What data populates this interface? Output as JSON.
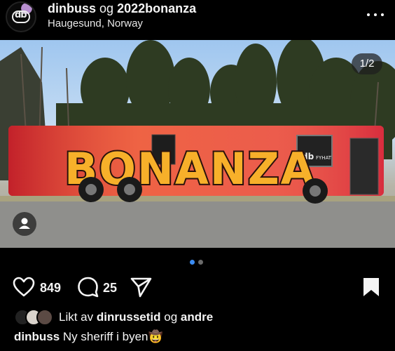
{
  "post": {
    "author": "dinbuss",
    "joiner": "og",
    "collaborator": "2022bonanza",
    "location": "Haugesund, Norway",
    "avatar_text": "db"
  },
  "media": {
    "counter": "1/2",
    "bus_text": "BONANZA",
    "sticker_text": "FYHAT"
  },
  "stats": {
    "likes": "849",
    "comments": "25"
  },
  "liked_by": {
    "prefix": "Likt av",
    "user": "dinrussetid",
    "joiner": "og",
    "others": "andre"
  },
  "caption": {
    "user": "dinbuss",
    "text": "Ny sheriff i byen",
    "emoji": "🤠"
  },
  "colors": {
    "active_dot": "#3b8cf2",
    "inactive_dot": "#6b6b6b",
    "background": "#000000"
  },
  "icons": [
    "more-icon",
    "person-tag-icon",
    "heart-icon",
    "comment-icon",
    "share-icon",
    "bookmark-icon"
  ]
}
